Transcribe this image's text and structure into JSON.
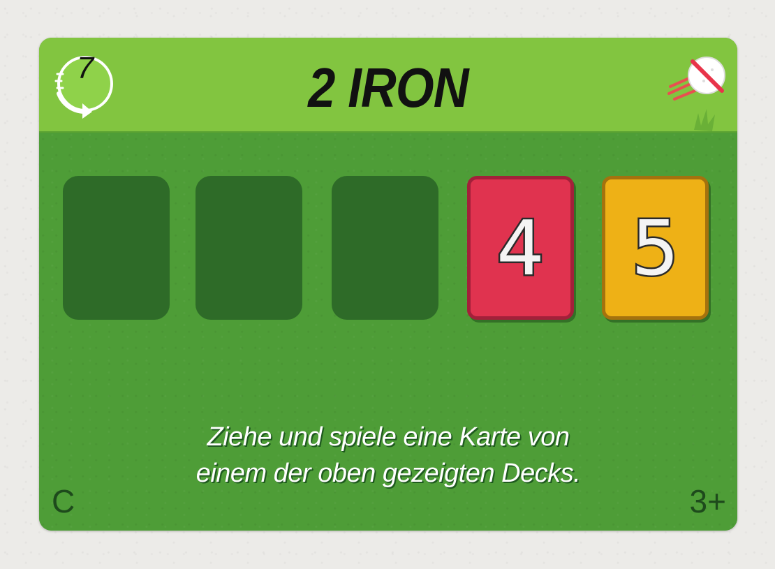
{
  "card": {
    "title": "2 IRON",
    "turn_value": "7",
    "decks": [
      {
        "value": "4",
        "color": "#e0334f"
      },
      {
        "value": "5",
        "color": "#eeb116"
      }
    ],
    "instruction_lines": [
      "Ziehe und spiele eine Karte von",
      "einem der oben gezeigten Decks."
    ],
    "corner_left": "C",
    "corner_right": "3+"
  },
  "colors": {
    "header_green": "#82c540",
    "body_green": "#4e9d37",
    "empty_slot": "#2e6b28"
  },
  "icons": {
    "turn_badge": "circular-arrow-icon",
    "top_right": "no-golf-ball-icon"
  }
}
